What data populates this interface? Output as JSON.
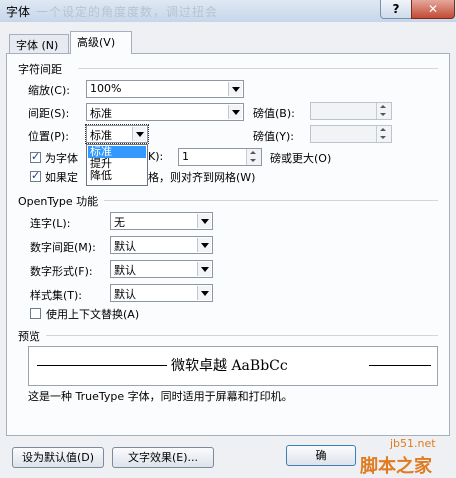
{
  "window": {
    "title": "字体",
    "faded_title": "一个设定的角度度数，调过扭会",
    "help": "?",
    "close": "✕"
  },
  "tabs": [
    {
      "label": "字体 (N)"
    },
    {
      "label": "高级(V)"
    }
  ],
  "spacing": {
    "section_label": "字符间距",
    "scale": {
      "label": "缩放(C):",
      "value": "100%"
    },
    "spacing": {
      "label": "间距(S):",
      "value": "标准",
      "pt_label": "磅值(B):"
    },
    "position": {
      "label": "位置(P):",
      "value": "标准",
      "pt_label": "磅值(Y):"
    },
    "position_options": [
      "标准",
      "提升",
      "降低"
    ],
    "kerning": {
      "label_part1": "为字体",
      "label_part2": "K):",
      "value": "1",
      "suffix": "磅或更大(O)"
    },
    "grid": {
      "label_part1": "如果定",
      "label_part2": "格，则对齐到网格(W)"
    }
  },
  "opentype": {
    "section_label": "OpenType 功能",
    "ligature": {
      "label": "连字(L):",
      "value": "无"
    },
    "num_spacing": {
      "label": "数字间距(M):",
      "value": "默认"
    },
    "num_form": {
      "label": "数字形式(F):",
      "value": "默认"
    },
    "style_set": {
      "label": "样式集(T):",
      "value": "默认"
    },
    "contextual": {
      "label": "使用上下文替换(A)"
    }
  },
  "preview": {
    "section_label": "预览",
    "sample": "微软卓越  AaBbCc",
    "note": "这是一种 TrueType 字体，同时适用于屏幕和打印机。"
  },
  "buttons": {
    "set_default": "设为默认值(D)",
    "text_effects": "文字效果(E)...",
    "ok_partial": "确"
  },
  "watermark": {
    "site": "jb51.net",
    "name": "脚本之家"
  }
}
